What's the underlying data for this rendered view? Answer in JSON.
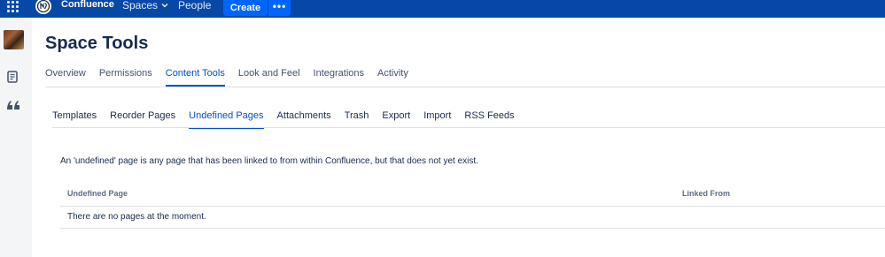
{
  "topbar": {
    "brand": "Confluence",
    "spaces_label": "Spaces",
    "people_label": "People",
    "create_label": "Create",
    "more_label": "•••"
  },
  "icons": {
    "app_switcher": "app-switcher-icon",
    "logo": "confluence-logo-icon",
    "spaces_chevron": "chevron-down-icon",
    "space_avatar": "space-avatar",
    "pages": "pages-icon",
    "blog": "quote-icon"
  },
  "page": {
    "title": "Space Tools"
  },
  "main_tabs": [
    {
      "label": "Overview"
    },
    {
      "label": "Permissions"
    },
    {
      "label": "Content Tools"
    },
    {
      "label": "Look and Feel"
    },
    {
      "label": "Integrations"
    },
    {
      "label": "Activity"
    }
  ],
  "sub_tabs": [
    {
      "label": "Templates"
    },
    {
      "label": "Reorder Pages"
    },
    {
      "label": "Undefined Pages"
    },
    {
      "label": "Attachments"
    },
    {
      "label": "Trash"
    },
    {
      "label": "Export"
    },
    {
      "label": "Import"
    },
    {
      "label": "RSS Feeds"
    }
  ],
  "content": {
    "description": "An 'undefined' page is any page that has been linked to from within Confluence, but that does not yet exist.",
    "table": {
      "columns": [
        "Undefined Page",
        "Linked From"
      ],
      "empty_message": "There are no pages at the moment."
    }
  },
  "colors": {
    "topbar": "#0747a6",
    "create_button": "#0065ff",
    "active_tab": "#0052cc",
    "sidebar": "#f4f5f7"
  }
}
